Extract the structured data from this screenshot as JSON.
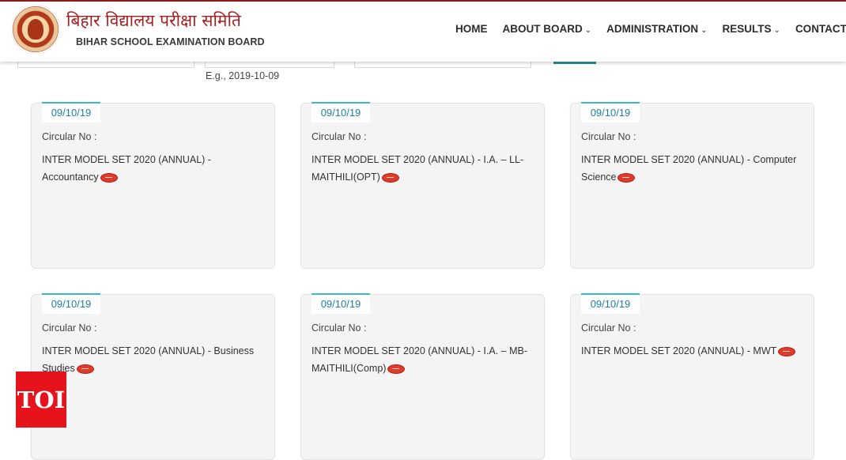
{
  "header": {
    "hindi_title": "बिहार विद्यालय परीक्षा समिति",
    "english_title": "BIHAR SCHOOL EXAMINATION BOARD",
    "logo_icon": "board-emblem-icon",
    "nav": [
      {
        "label": "HOME",
        "dropdown": false
      },
      {
        "label": "ABOUT BOARD",
        "dropdown": true
      },
      {
        "label": "ADMINISTRATION",
        "dropdown": true
      },
      {
        "label": "RESULTS",
        "dropdown": true
      },
      {
        "label": "CONTACT US",
        "dropdown": false
      }
    ],
    "chevron": "⌄"
  },
  "search": {
    "date_hint": "E.g., 2019-10-09"
  },
  "circular_label": "Circular No :",
  "cards": [
    {
      "date": "09/10/19",
      "title": "INTER MODEL SET 2020 (ANNUAL) - Accountancy",
      "badge_icon": "new-badge-icon"
    },
    {
      "date": "09/10/19",
      "title": "INTER MODEL SET 2020 (ANNUAL) - I.A. – LL-MAITHILI(OPT)",
      "badge_icon": "new-badge-icon"
    },
    {
      "date": "09/10/19",
      "title": "INTER MODEL SET 2020 (ANNUAL) - Computer Science",
      "badge_icon": "new-badge-icon"
    },
    {
      "date": "09/10/19",
      "title": "INTER MODEL SET 2020 (ANNUAL) - Business Studies",
      "badge_icon": "new-badge-icon"
    },
    {
      "date": "09/10/19",
      "title": "INTER MODEL SET 2020 (ANNUAL) - I.A. – MB-MAITHILI(Comp)",
      "badge_icon": "new-badge-icon"
    },
    {
      "date": "09/10/19",
      "title": "INTER MODEL SET 2020 (ANNUAL) - MWT",
      "badge_icon": "new-badge-icon"
    }
  ],
  "watermark": {
    "text": "TOI"
  },
  "colors": {
    "brand_red": "#a41f1f",
    "date_text": "#1c7fa3",
    "date_accent": "#3db8c5",
    "tab_underline": "#2a8f96",
    "toi_red": "#e6121c"
  }
}
